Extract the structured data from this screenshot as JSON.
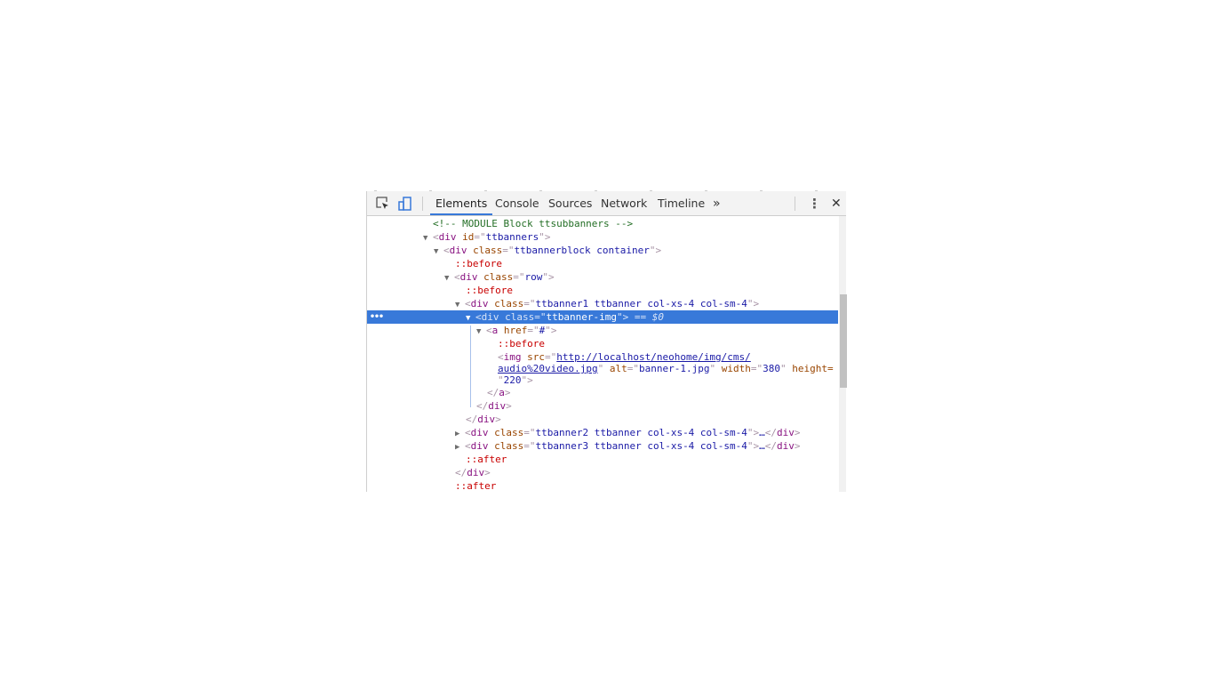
{
  "toolbar": {
    "inspect_icon": "inspect-element-icon",
    "device_icon": "device-toolbar-icon",
    "tabs": [
      {
        "label": "Elements",
        "active": true
      },
      {
        "label": "Console",
        "active": false
      },
      {
        "label": "Sources",
        "active": false
      },
      {
        "label": "Network",
        "active": false
      },
      {
        "label": "Timeline",
        "active": false
      }
    ],
    "more_tabs": "»",
    "menu": "⋮",
    "close": "✕"
  },
  "tree": {
    "comment": "<!-- MODULE Block ttsubbanners -->",
    "div_ttbanners_id": "ttbanners",
    "div_block_class": "ttbannerblock container",
    "before": "::before",
    "after": "::after",
    "row_class": "row",
    "banner1_class": "ttbanner1 ttbanner col-xs-4 col-sm-4",
    "selected_class": "ttbanner-img",
    "selected_suffix": "== $0",
    "a_href": "#",
    "img_src_1": "http://localhost/neohome/img/cms/",
    "img_src_2": "audio%20video.jpg",
    "img_alt": "banner-1.jpg",
    "img_width": "380",
    "img_height": "220",
    "banner2_class": "ttbanner2 ttbanner col-xs-4 col-sm-4",
    "banner3_class": "ttbanner3 ttbanner col-xs-4 col-sm-4",
    "ellipsis": "…",
    "dots": "•••"
  },
  "colors": {
    "selection": "#3879d9",
    "tag": "#881280",
    "attribute": "#994500",
    "value": "#1a1aa6",
    "pseudo": "#c80000",
    "comment": "#236e25"
  }
}
